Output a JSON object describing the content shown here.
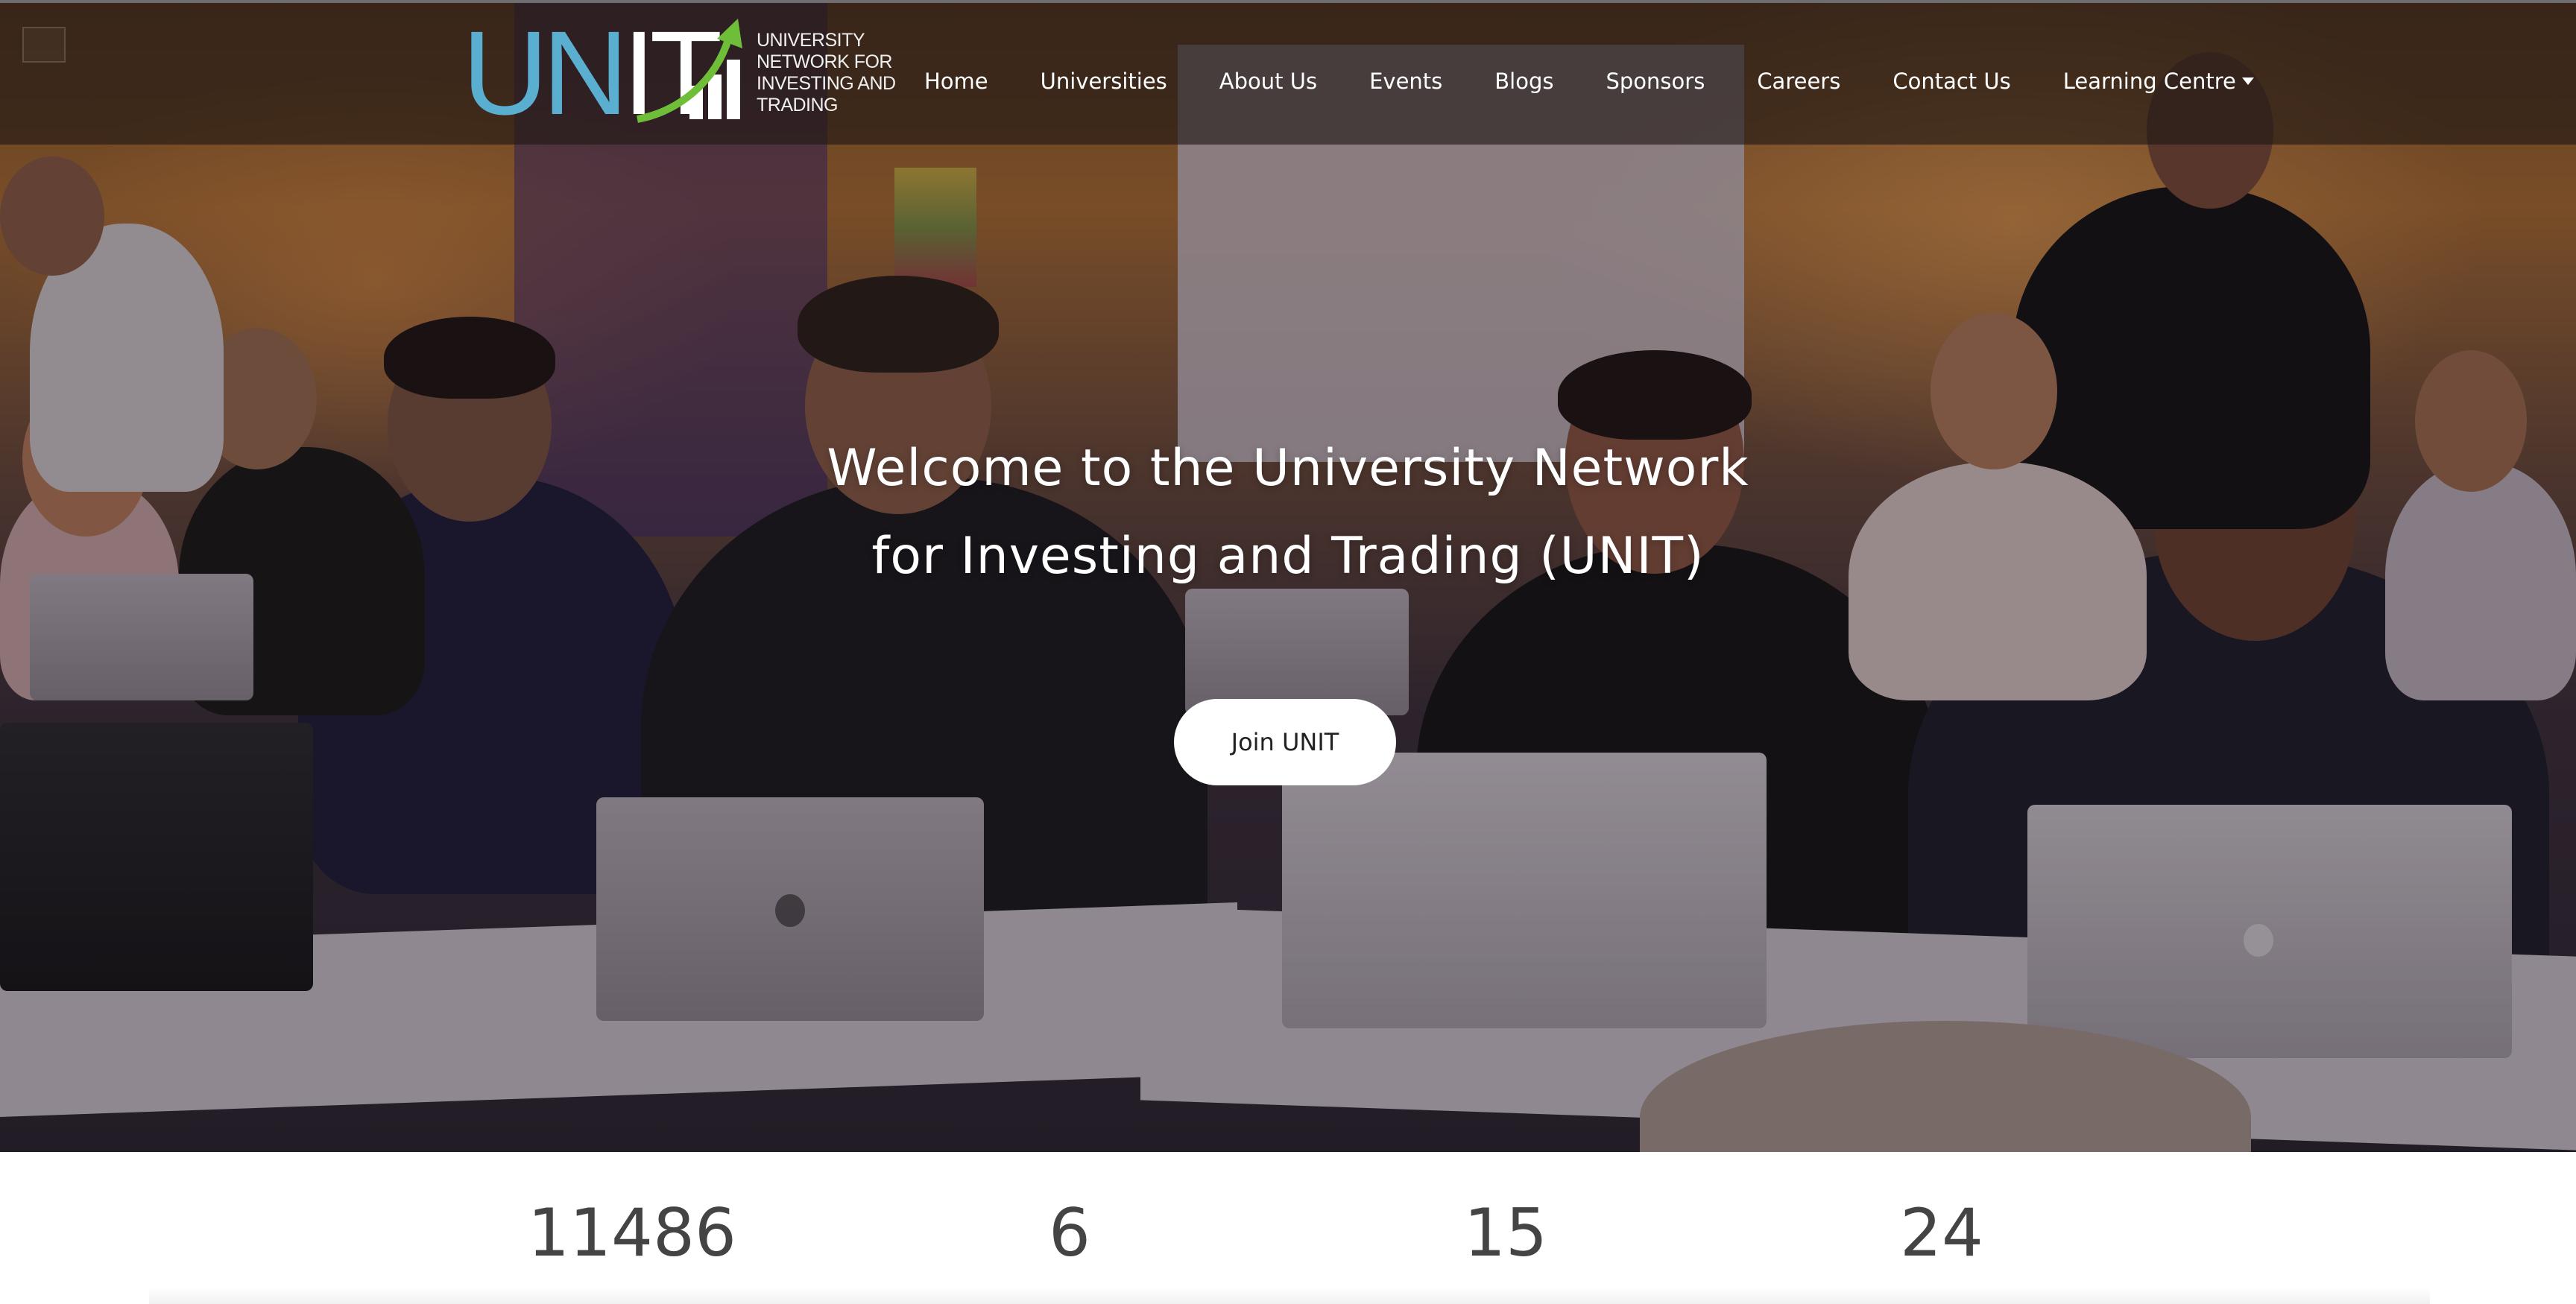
{
  "brand": {
    "logo_text": "UNIT",
    "tagline_lines": [
      "UNIVERSITY",
      "NETWORK FOR",
      "INVESTING AND",
      "TRADING"
    ]
  },
  "nav": {
    "items": [
      "Home",
      "Universities",
      "About Us",
      "Events",
      "Blogs",
      "Sponsors",
      "Careers",
      "Contact Us",
      "Learning Centre"
    ],
    "dropdown_icon": "caret-down-icon"
  },
  "hero": {
    "title_line1": "Welcome to the University Network",
    "title_line2": "for Investing and Trading (UNIT)",
    "cta_label": "Join UNIT"
  },
  "stats": {
    "values": [
      "11486",
      "6",
      "15",
      "24"
    ]
  },
  "colors": {
    "logo_blue": "#5aaed0",
    "logo_green": "#6fbe3a",
    "stat_text": "#444444"
  }
}
